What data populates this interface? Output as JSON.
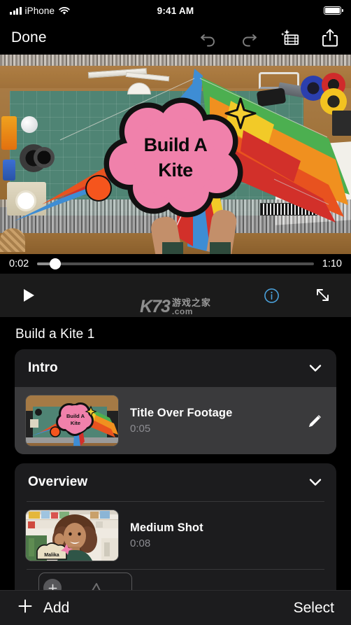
{
  "status_bar": {
    "carrier": "iPhone",
    "time": "9:41 AM",
    "signal_icon": "cellular-bars-icon",
    "wifi_icon": "wifi-icon",
    "battery_icon": "battery-full-icon"
  },
  "nav": {
    "done_label": "Done",
    "undo_icon": "undo-arrow-icon",
    "redo_icon": "redo-arrow-icon",
    "magic_movie_icon": "film-sparkle-icon",
    "share_icon": "share-up-arrow-icon"
  },
  "preview": {
    "title_line1": "Build A",
    "title_line2": "Kite",
    "sparkle_icon": "four-point-star-icon",
    "bubble_color": "#f081ab",
    "sparkle_color": "#f5cf32",
    "dot_color": "#f5551d"
  },
  "scrubber": {
    "current_time": "0:02",
    "total_time": "1:10",
    "progress_percent": 6.5
  },
  "playback": {
    "play_icon": "play-triangle-icon",
    "info_icon": "info-circle-icon",
    "info_color": "#4a9fd8",
    "expand_icon": "expand-diagonal-arrows-icon"
  },
  "watermark": {
    "brand": "K73",
    "cn_top": "游戏之家",
    "cn_bottom": ".com"
  },
  "storyboard": {
    "project_title": "Build a Kite 1",
    "sections": [
      {
        "title": "Intro",
        "chevron_icon": "chevron-down-icon",
        "clips": [
          {
            "name": "Title Over Footage",
            "duration": "0:05",
            "selected": true,
            "edit_icon": "pencil-icon",
            "thumbnail": "kite-title-thumbnail"
          }
        ]
      },
      {
        "title": "Overview",
        "chevron_icon": "chevron-down-icon",
        "clips": [
          {
            "name": "Medium Shot",
            "duration": "0:08",
            "selected": false,
            "thumbnail": "malika-medium-shot-thumbnail",
            "thumbnail_label": "Malika"
          }
        ],
        "add_placeholder_icon": "plus-circle-icon"
      }
    ]
  },
  "bottom_bar": {
    "add_label": "Add",
    "add_icon": "plus-icon",
    "select_label": "Select"
  }
}
